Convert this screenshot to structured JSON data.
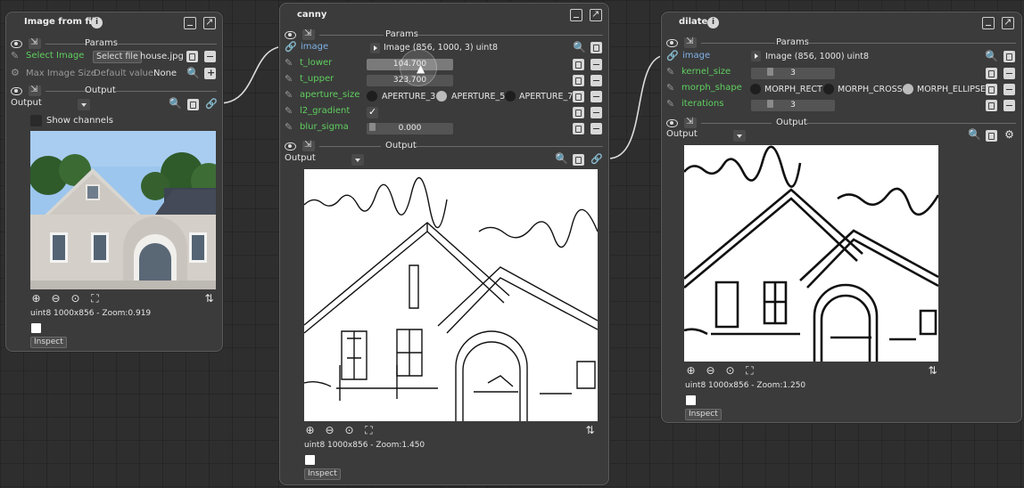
{
  "node_image_from_file": {
    "title": "Image from file",
    "params_header": "Params",
    "select_image_label": "Select Image",
    "select_file_button": "Select file",
    "filename": "house.jpg",
    "max_image_size_label": "Max Image Size",
    "default_value_label": "Default value:",
    "default_value": "None",
    "output_header": "Output",
    "output_label": "Output",
    "show_channels_label": "Show channels",
    "image_info": "uint8 1000x856 - Zoom:0.919",
    "inspect_button": "Inspect"
  },
  "node_canny": {
    "title": "canny",
    "params_header": "Params",
    "image_param_label": "image",
    "image_param_value": "Image (856, 1000, 3) uint8",
    "t_lower_label": "t_lower",
    "t_lower_value": "104.700",
    "t_upper_label": "t_upper",
    "t_upper_value": "323.700",
    "aperture_size_label": "aperture_size",
    "aperture_options": [
      "APERTURE_3",
      "APERTURE_5",
      "APERTURE_7"
    ],
    "aperture_selected": "APERTURE_5",
    "l2_gradient_label": "l2_gradient",
    "l2_gradient_checked": true,
    "blur_sigma_label": "blur_sigma",
    "blur_sigma_value": "0.000",
    "output_header": "Output",
    "output_label": "Output",
    "image_info": "uint8 1000x856 - Zoom:1.450",
    "inspect_button": "Inspect"
  },
  "node_dilate": {
    "title": "dilate",
    "params_header": "Params",
    "image_param_label": "image",
    "image_param_value": "Image (856, 1000) uint8",
    "kernel_size_label": "kernel_size",
    "kernel_size_value": "3",
    "morph_shape_label": "morph_shape",
    "morph_options": [
      "MORPH_RECT",
      "MORPH_CROSS",
      "MORPH_ELLIPSE"
    ],
    "morph_selected": "MORPH_ELLIPSE",
    "iterations_label": "iterations",
    "iterations_value": "3",
    "output_header": "Output",
    "output_label": "Output",
    "image_info": "uint8 1000x856 - Zoom:1.250",
    "inspect_button": "Inspect"
  },
  "icons": [
    "eye-icon",
    "collapse-icon",
    "pencil-icon",
    "link-icon",
    "copy-icon",
    "minus-icon",
    "plus-icon",
    "zoom-in-icon",
    "zoom-out-icon",
    "zoom-reset-icon",
    "fit-icon",
    "settings-icon",
    "minimize-icon",
    "popout-icon",
    "info-icon"
  ],
  "colors": {
    "param_label_green": "#5fcf5f",
    "link_blue": "#7fb2e8",
    "node_bg": "#3b3b3b",
    "canvas_bg": "#2e2e2e"
  }
}
